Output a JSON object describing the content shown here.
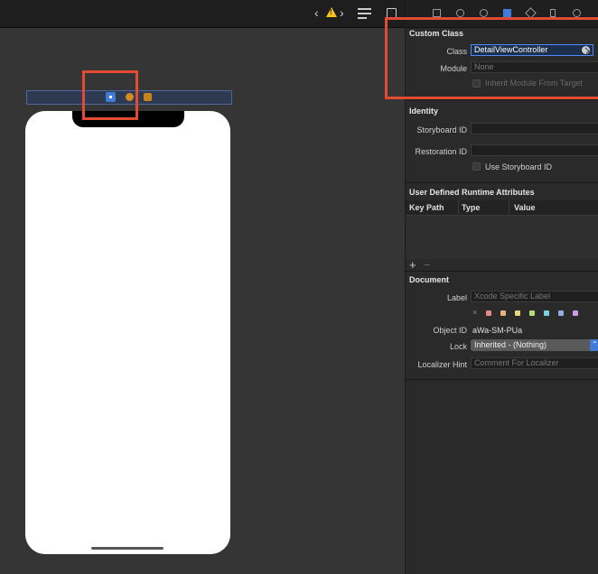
{
  "toolbar": {
    "back_icon": "chevron-left-icon",
    "warning_icon": "warning-icon",
    "forward_icon": "chevron-right-icon",
    "editor_options_icon": "lines-icon",
    "back_glyph": "‹",
    "forward_glyph": "›"
  },
  "inspector": {
    "tabs": [
      "file-icon",
      "history-icon",
      "help-icon",
      "identity-icon",
      "attributes-icon",
      "size-icon",
      "connections-icon"
    ],
    "active_tab": "identity-icon",
    "custom_class": {
      "title": "Custom Class",
      "class_label": "Class",
      "class_value": "DetailViewController",
      "module_label": "Module",
      "module_placeholder": "None",
      "inherit_label": "Inherit Module From Target"
    },
    "identity": {
      "title": "Identity",
      "storyboard_id_label": "Storyboard ID",
      "restoration_id_label": "Restoration ID",
      "use_storyboard_id_label": "Use Storyboard ID"
    },
    "runtime_attributes": {
      "title": "User Defined Runtime Attributes",
      "columns": [
        "Key Path",
        "Type",
        "Value"
      ],
      "add_label": "+",
      "remove_label": "−"
    },
    "document": {
      "title": "Document",
      "label_label": "Label",
      "label_placeholder": "Xcode Specific Label",
      "clear_label": "×",
      "color_swatches": [
        "#e58a8a",
        "#e5b27a",
        "#e5d67a",
        "#b6d97a",
        "#7ad0e5",
        "#9aa7e5",
        "#d09ae5"
      ],
      "object_id_label": "Object ID",
      "object_id_value": "aWa-SM-PUa",
      "lock_label": "Lock",
      "lock_value": "Inherited - (Nothing)",
      "localizer_hint_label": "Localizer Hint",
      "localizer_hint_placeholder": "Comment For Localizer"
    }
  },
  "colors": {
    "accent": "#3f7bd8",
    "highlight": "#e24a33"
  }
}
